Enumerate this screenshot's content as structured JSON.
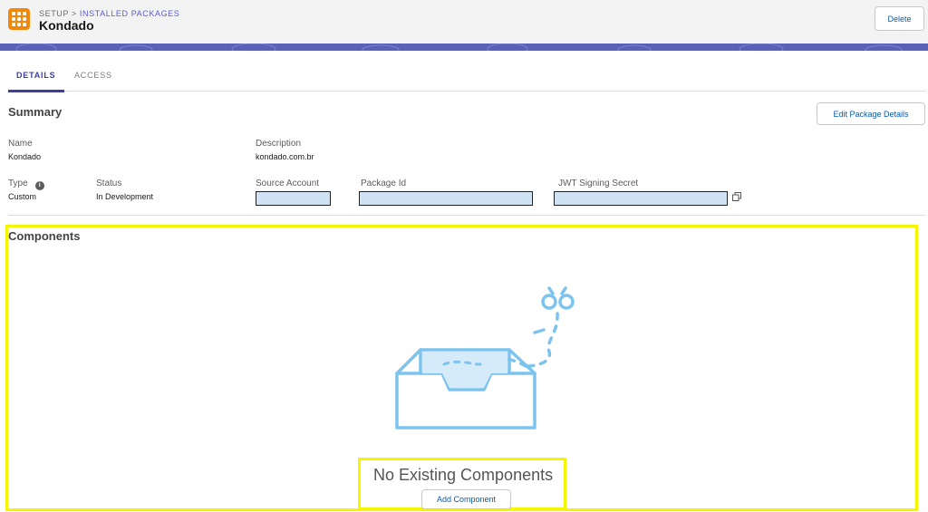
{
  "header": {
    "breadcrumb_root": "SETUP",
    "breadcrumb_separator": ">",
    "breadcrumb_current": "INSTALLED PACKAGES",
    "title": "Kondado",
    "delete_label": "Delete",
    "app_icon": "app-launcher-icon",
    "accent_color": "#f2870e",
    "banner_color": "#5a61b8"
  },
  "tabs": [
    {
      "label": "DETAILS",
      "active": true
    },
    {
      "label": "ACCESS",
      "active": false
    }
  ],
  "summary": {
    "title": "Summary",
    "edit_label": "Edit Package Details",
    "name_label": "Name",
    "name_value": "Kondado",
    "description_label": "Description",
    "description_value": "kondado.com.br",
    "type_label": "Type",
    "type_value": "Custom",
    "status_label": "Status",
    "status_value": "In Development",
    "source_account_label": "Source Account",
    "package_id_label": "Package Id",
    "jwt_label": "JWT Signing Secret",
    "info_icon": "info-icon",
    "copy_icon": "copy-icon"
  },
  "components": {
    "title": "Components",
    "empty_title": "No Existing Components",
    "add_label": "Add Component",
    "illustration": "empty-inbox-illustration",
    "highlight_color": "#f5f500",
    "illustration_color": "#7cc3ee"
  }
}
